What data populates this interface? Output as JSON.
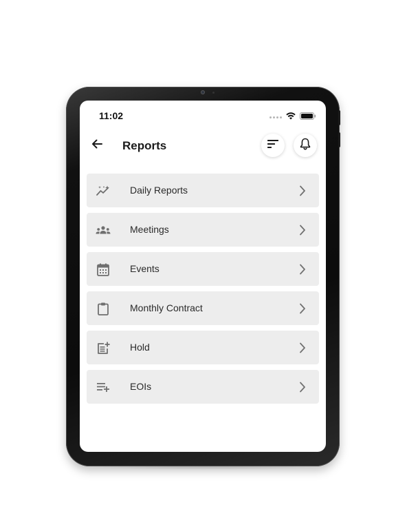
{
  "status_bar": {
    "time": "11:02"
  },
  "header": {
    "title": "Reports",
    "back_icon": "arrow-left-icon",
    "filter_icon": "filter-lines-icon",
    "notification_icon": "bell-icon"
  },
  "menu": {
    "items": [
      {
        "label": "Daily Reports",
        "icon": "sparkle-trend-icon"
      },
      {
        "label": "Meetings",
        "icon": "group-icon"
      },
      {
        "label": "Events",
        "icon": "calendar-icon"
      },
      {
        "label": "Monthly Contract",
        "icon": "clipboard-icon"
      },
      {
        "label": "Hold",
        "icon": "post-add-icon"
      },
      {
        "label": "EOIs",
        "icon": "playlist-add-icon"
      }
    ]
  },
  "colors": {
    "item_background": "#ededed",
    "icon_gray": "#6f6f6f",
    "text_dark": "#2a2a2a",
    "chevron_gray": "#707070"
  }
}
